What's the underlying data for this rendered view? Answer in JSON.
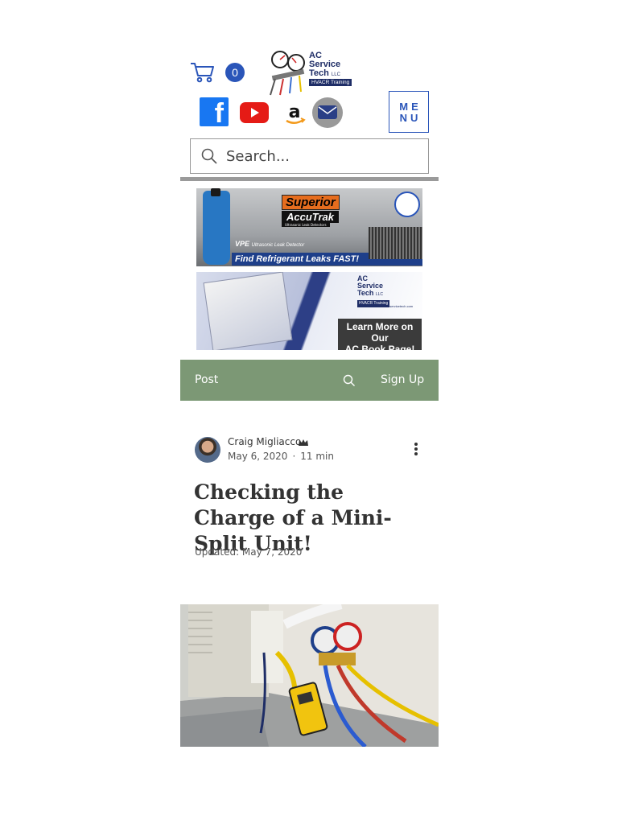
{
  "header": {
    "cart_count": "0",
    "logo": {
      "line1": "AC",
      "line2": "Service",
      "line3": "Tech",
      "llc": "LLC",
      "badge": "HVACR Training"
    },
    "menu_label_line1": "ME",
    "menu_label_line2": "NU",
    "social": [
      "facebook-icon",
      "youtube-icon",
      "amazon-icon",
      "mail-icon"
    ],
    "search_placeholder": "Search..."
  },
  "banners": {
    "accutrak": {
      "brand": "Superior",
      "model": "AccuTrak",
      "sub": "Ultrasonic Leak Detectors",
      "vpe": "VPE",
      "vpe_desc": "Ultrasonic Leak Detector",
      "slogan": "Find Refrigerant Leaks FAST!"
    },
    "book": {
      "logo_line1": "AC",
      "logo_line2": "Service",
      "logo_line3": "Tech",
      "llc": "LLC",
      "logo_badge": "HVACR Training",
      "url": "acservicetech.com",
      "cta_line1": "Learn More on Our",
      "cta_line2": "AC Book Page!"
    }
  },
  "blog_nav": {
    "post_label": "Post",
    "signup_label": "Sign Up"
  },
  "post": {
    "author": "Craig Migliacco",
    "date": "May 6, 2020",
    "read_time": "11 min",
    "title": "Checking the Charge of a Mini-Split Unit!",
    "updated": "Updated: May 7, 2020"
  },
  "colors": {
    "accent_blue": "#2a55b9",
    "nav_green": "#7c9875",
    "facebook": "#1877f2",
    "youtube": "#e51b16"
  }
}
